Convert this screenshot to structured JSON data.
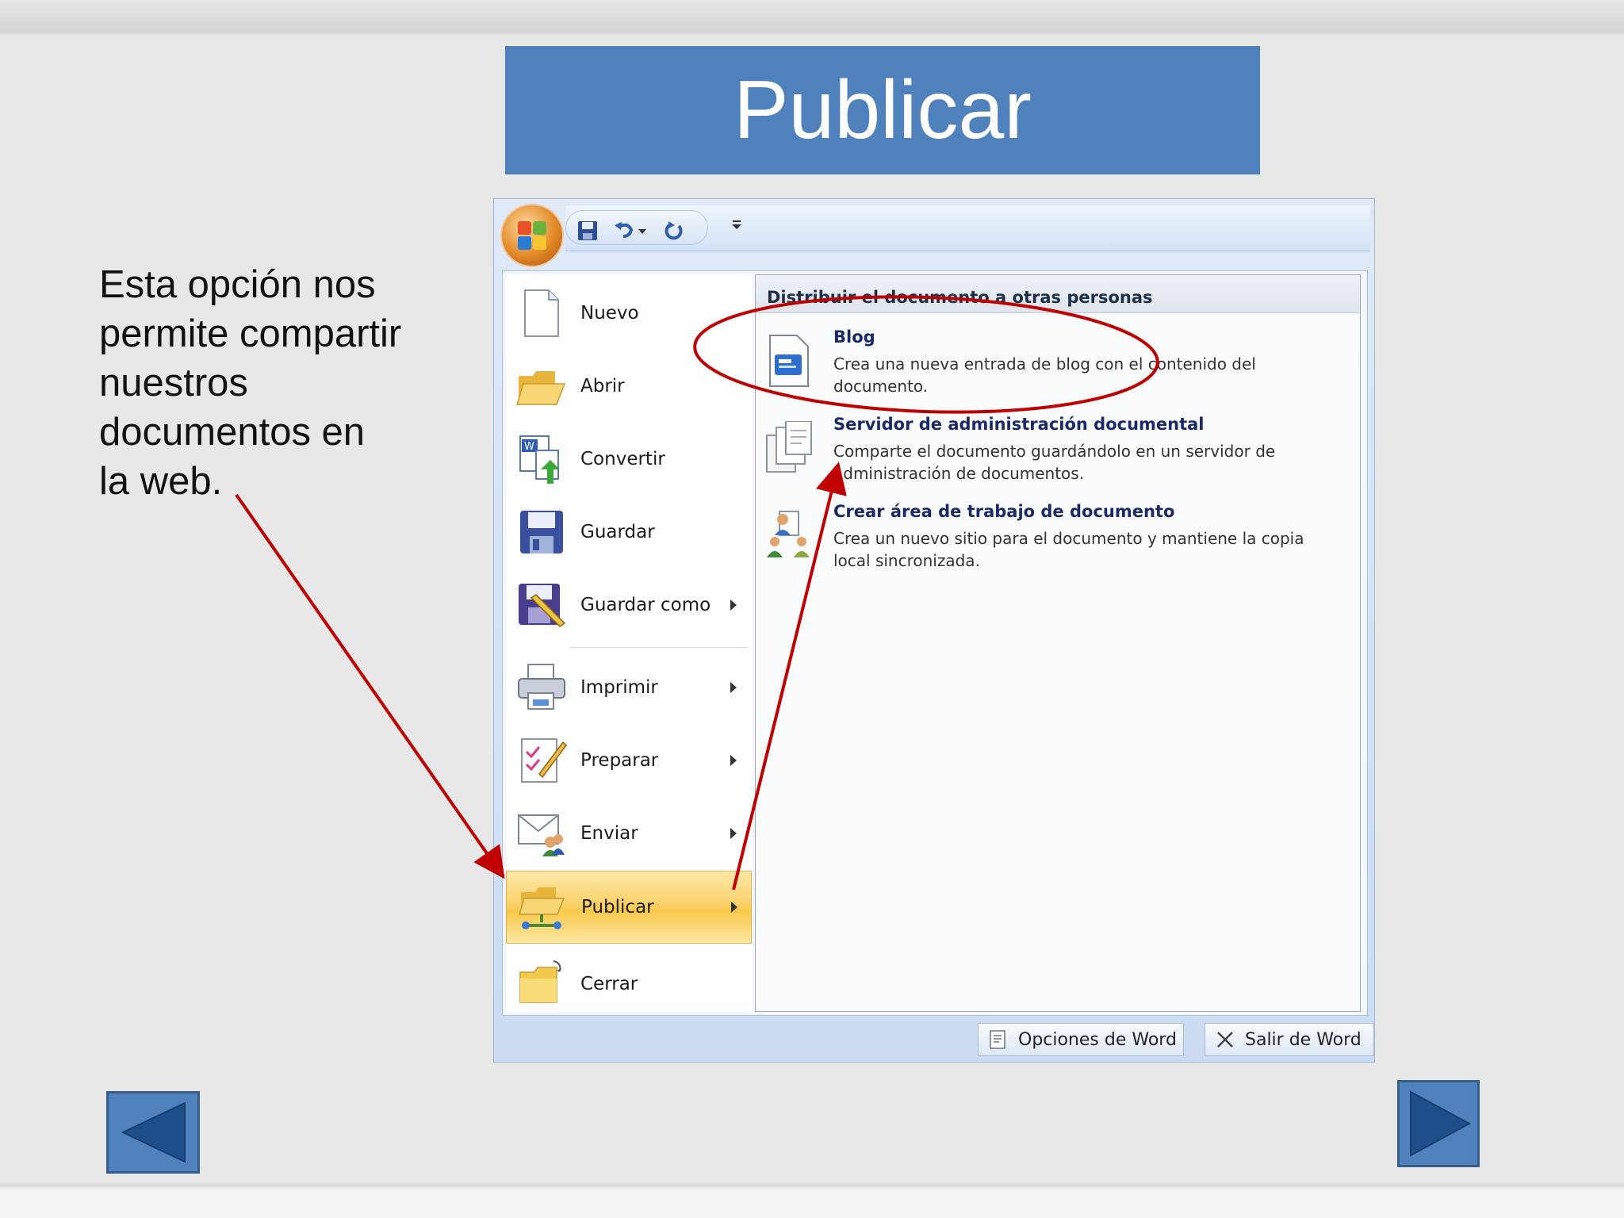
{
  "slide": {
    "title": "Publicar",
    "description": "Esta opción nos\npermite compartir\nnuestros\ndocumentos  en\nla web."
  },
  "office_menu": {
    "left_items": [
      {
        "label": "Nuevo",
        "icon": "new-document-icon",
        "has_submenu": false
      },
      {
        "label": "Abrir",
        "icon": "open-folder-icon",
        "has_submenu": false
      },
      {
        "label": "Convertir",
        "icon": "convert-icon",
        "has_submenu": false
      },
      {
        "label": "Guardar",
        "icon": "save-icon",
        "has_submenu": false
      },
      {
        "label": "Guardar como",
        "icon": "save-as-icon",
        "has_submenu": true
      },
      {
        "label": "Imprimir",
        "icon": "printer-icon",
        "has_submenu": true
      },
      {
        "label": "Preparar",
        "icon": "prepare-icon",
        "has_submenu": true
      },
      {
        "label": "Enviar",
        "icon": "send-icon",
        "has_submenu": true
      },
      {
        "label": "Publicar",
        "icon": "publish-icon",
        "has_submenu": true,
        "active": true
      },
      {
        "label": "Cerrar",
        "icon": "close-folder-icon",
        "has_submenu": false
      }
    ],
    "right_panel": {
      "header": "Distribuir el documento a otras personas",
      "items": [
        {
          "title": "Blog",
          "description": "Crea una nueva entrada de blog con el contenido del documento.",
          "icon": "blog-icon"
        },
        {
          "title": "Servidor de administración documental",
          "description": "Comparte el documento guardándolo en un servidor de administración de documentos.",
          "icon": "document-server-icon"
        },
        {
          "title": "Crear área de trabajo de documento",
          "description": "Crea un nuevo sitio para el documento y mantiene la copia local sincronizada.",
          "icon": "workspace-icon"
        }
      ]
    },
    "bottom_buttons": {
      "options": "Opciones de Word",
      "exit": "Salir de Word"
    }
  },
  "colors": {
    "title_bg": "#4f81bd",
    "annotation": "#c00000",
    "active_item": "#f9c849"
  }
}
